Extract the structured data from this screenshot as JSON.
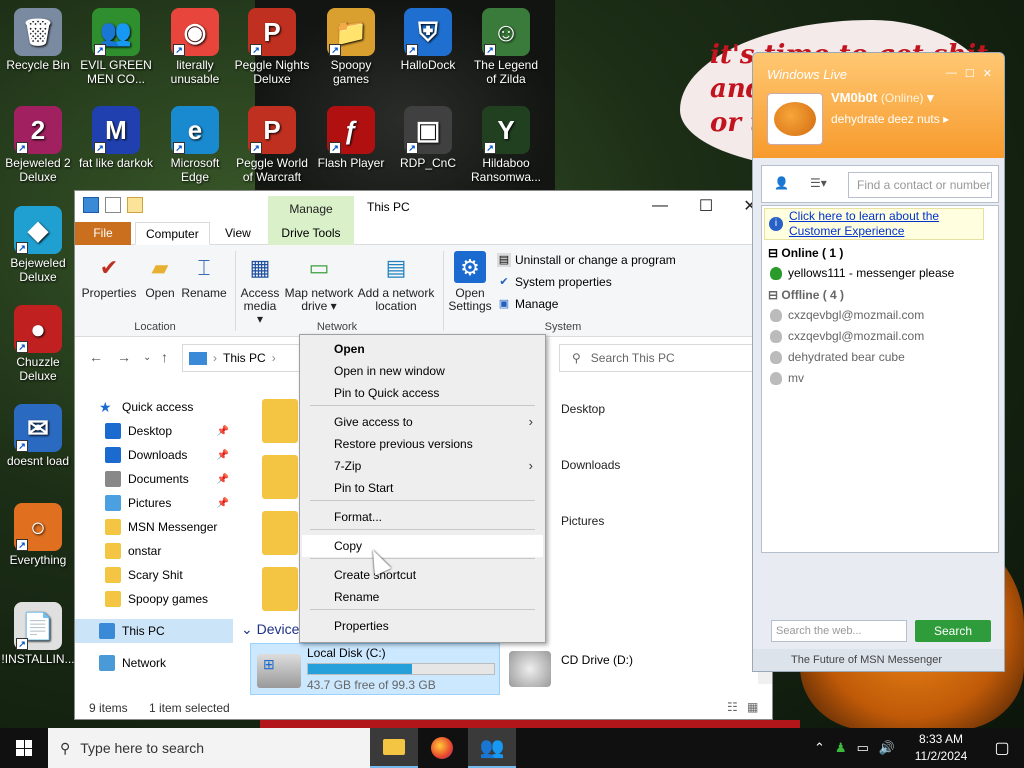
{
  "wallpaper": {
    "bubble_text": "it's time to get shit\nand\nor t"
  },
  "desktop_icons": [
    {
      "label": "Recycle Bin",
      "glyph": "🗑",
      "color": "#7a8aa0"
    },
    {
      "label": "EVIL GREEN MEN CO...",
      "glyph": "👥",
      "color": "#2f8f2f"
    },
    {
      "label": "literally unusable",
      "glyph": "◉",
      "color": "#e8453c"
    },
    {
      "label": "Peggle Nights Deluxe",
      "glyph": "P",
      "color": "#c03020"
    },
    {
      "label": "Spoopy games",
      "glyph": "📁",
      "color": "#d9a030"
    },
    {
      "label": "HalloDock",
      "glyph": "⛨",
      "color": "#1f6fd0"
    },
    {
      "label": "The Legend of Zilda",
      "glyph": "☺",
      "color": "#3a7a3a"
    },
    {
      "label": "Bejeweled 2 Deluxe",
      "glyph": "2",
      "color": "#a02060"
    },
    {
      "label": "fat like darkok",
      "glyph": "M",
      "color": "#2040b0"
    },
    {
      "label": "Microsoft Edge",
      "glyph": "e",
      "color": "#1a8ad0"
    },
    {
      "label": "Peggle World of Warcraft",
      "glyph": "P",
      "color": "#c03020"
    },
    {
      "label": "Flash Player",
      "glyph": "ƒ",
      "color": "#b01010"
    },
    {
      "label": "RDP_CnC",
      "glyph": "▣",
      "color": "#404040"
    },
    {
      "label": "Hildaboo Ransomwa...",
      "glyph": "Y",
      "color": "#204020"
    },
    {
      "label": "Bejeweled Deluxe",
      "glyph": "◆",
      "color": "#20a0d0"
    },
    {
      "label": "Chuzzle Deluxe",
      "glyph": "●",
      "color": "#c02020"
    },
    {
      "label": "doesnt load",
      "glyph": "✉",
      "color": "#2a6ac0"
    },
    {
      "label": "Everything",
      "glyph": "○",
      "color": "#e07020"
    },
    {
      "label": "!INSTALLIN...",
      "glyph": "📄",
      "color": "#e0e0e0"
    }
  ],
  "explorer": {
    "title": "This PC",
    "manage_tab": "Manage",
    "tabs": {
      "file": "File",
      "computer": "Computer",
      "view": "View",
      "drive_tools": "Drive Tools"
    },
    "ribbon": {
      "properties": "Properties",
      "open": "Open",
      "rename": "Rename",
      "access_media": "Access media ▾",
      "map_network": "Map network drive ▾",
      "add_network": "Add a network location",
      "open_settings": "Open Settings",
      "uninstall": "Uninstall or change a program",
      "system_properties": "System properties",
      "manage": "Manage",
      "group_location": "Location",
      "group_network": "Network",
      "group_system": "System"
    },
    "address": {
      "path": "This PC",
      "search_placeholder": "Search This PC"
    },
    "nav": {
      "quick_access": "Quick access",
      "items": [
        "Desktop",
        "Downloads",
        "Documents",
        "Pictures",
        "MSN Messenger",
        "onstar",
        "Scary Shit",
        "Spoopy games"
      ],
      "this_pc": "This PC",
      "network": "Network"
    },
    "content": {
      "folders": [
        "Desktop",
        "Downloads",
        "Pictures"
      ],
      "devices_header": "Devices and drives",
      "local_disk": {
        "name": "Local Disk (C:)",
        "free": "43.7 GB free of 99.3 GB",
        "used_fraction": 0.56
      },
      "cd_drive": "CD Drive (D:)"
    },
    "status": {
      "items": "9 items",
      "selected": "1 item selected"
    }
  },
  "context_menu": {
    "items": [
      "Open",
      "Open in new window",
      "Pin to Quick access",
      "Give access to",
      "Restore previous versions",
      "7-Zip",
      "Pin to Start",
      "Format...",
      "Copy",
      "Create shortcut",
      "Rename",
      "Properties"
    ]
  },
  "msn": {
    "logo": "Windows Live",
    "name": "VM0b0t",
    "status": "(Online)",
    "personal_message": "dehydrate deez nuts",
    "find_placeholder": "Find a contact or number",
    "ad": "Click here to learn about the Customer Experience",
    "online_header": "Online ( 1 )",
    "online_contacts": [
      "yellows111 - messenger please"
    ],
    "offline_header": "Offline ( 4 )",
    "offline_contacts": [
      "cxzqevbgl@mozmail.com",
      "cxzqevbgl@mozmail.com",
      "dehydrated bear cube",
      "mv"
    ],
    "web_search_placeholder": "Search the web...",
    "search_button": "Search",
    "footer": "The Future of MSN Messenger"
  },
  "taskbar": {
    "search_placeholder": "Type here to search",
    "time": "8:33 AM",
    "date": "11/2/2024"
  }
}
